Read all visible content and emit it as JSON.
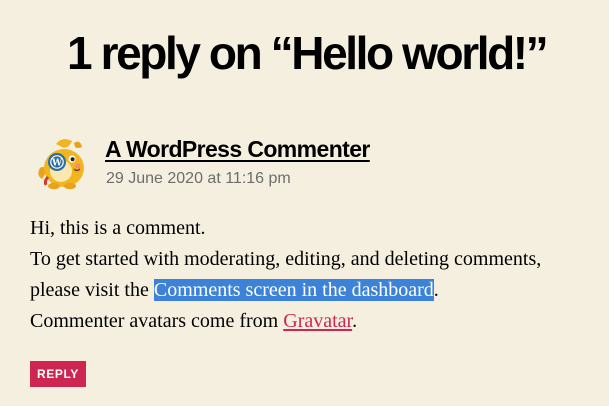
{
  "comments": {
    "title": "1 reply on “Hello world!”"
  },
  "comment": {
    "avatar_icon": "wapuu-avatar-icon",
    "author": "A WordPress Commenter",
    "date": "29 June 2020 at 11:16 pm",
    "line1": "Hi, this is a comment.",
    "line2": "To get started with moderating, editing, and deleting comments,",
    "line3_prefix": "please visit the ",
    "line3_link": "Comments screen in the dashboard",
    "line3_suffix": ".",
    "line4_prefix": "Commenter avatars come from ",
    "line4_link": "Gravatar",
    "line4_suffix": ".",
    "reply_label": "Reply"
  },
  "colors": {
    "background": "#f5efe0",
    "accent": "#cd2653",
    "selection": "#3b82d8",
    "meta_text": "#6d6d6d"
  }
}
